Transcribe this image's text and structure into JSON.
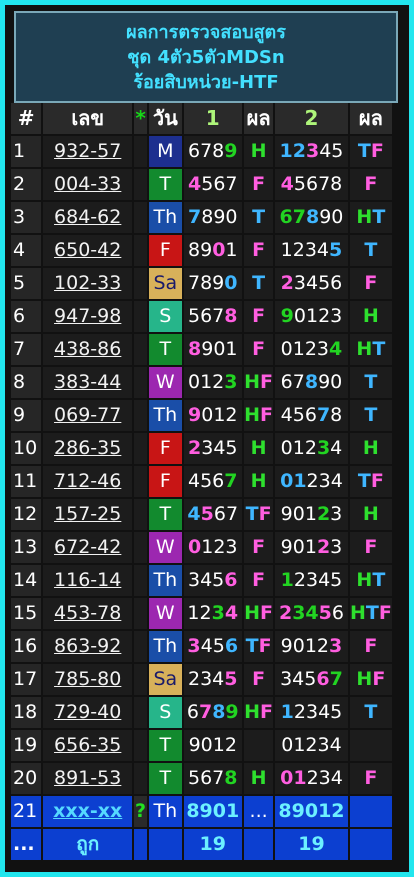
{
  "header": {
    "line1": "ผลการตรวจสอบสูตร",
    "line2": "ชุด 4ตัว5ตัวMDSn",
    "line3": "ร้อยสิบหน่วย-HTF"
  },
  "columns": {
    "idx": "#",
    "lek": "เลข",
    "star": "*",
    "day": "วัน",
    "set1": "1",
    "res1": "ผล",
    "set2": "2",
    "res2": "ผล"
  },
  "rows": [
    {
      "idx": "1",
      "lek": "932-57",
      "day": "M",
      "n1": [
        [
          "678",
          ""
        ],
        [
          "9",
          "h-green"
        ]
      ],
      "r1": "H",
      "n2": [
        [
          "12",
          "h-blue"
        ],
        [
          "3",
          "h-pink"
        ],
        [
          "45",
          ""
        ]
      ],
      "r2": "TF"
    },
    {
      "idx": "2",
      "lek": "004-33",
      "day": "T",
      "n1": [
        [
          "4",
          "h-pink"
        ],
        [
          "567",
          ""
        ]
      ],
      "r1": "F",
      "n2": [
        [
          "4",
          "h-pink"
        ],
        [
          "5678",
          ""
        ]
      ],
      "r2": "F"
    },
    {
      "idx": "3",
      "lek": "684-62",
      "day": "Th",
      "n1": [
        [
          "7",
          "h-blue"
        ],
        [
          "890",
          ""
        ]
      ],
      "r1": "T",
      "n2": [
        [
          "67",
          "h-green"
        ],
        [
          "8",
          "h-blue"
        ],
        [
          "90",
          ""
        ]
      ],
      "r2": "HT"
    },
    {
      "idx": "4",
      "lek": "650-42",
      "day": "F",
      "n1": [
        [
          "89",
          ""
        ],
        [
          "0",
          "h-pink"
        ],
        [
          "1",
          ""
        ]
      ],
      "r1": "F",
      "n2": [
        [
          "1234",
          ""
        ],
        [
          "5",
          "h-blue"
        ]
      ],
      "r2": "T"
    },
    {
      "idx": "5",
      "lek": "102-33",
      "day": "Sa",
      "n1": [
        [
          "789",
          ""
        ],
        [
          "0",
          "h-blue"
        ]
      ],
      "r1": "T",
      "n2": [
        [
          "2",
          "h-pink"
        ],
        [
          "3456",
          ""
        ]
      ],
      "r2": "F"
    },
    {
      "idx": "6",
      "lek": "947-98",
      "day": "S",
      "n1": [
        [
          "567",
          ""
        ],
        [
          "8",
          "h-pink"
        ]
      ],
      "r1": "F",
      "n2": [
        [
          "9",
          "h-green"
        ],
        [
          "0123",
          ""
        ]
      ],
      "r2": "H"
    },
    {
      "idx": "7",
      "lek": "438-86",
      "day": "T",
      "n1": [
        [
          "8",
          "h-pink"
        ],
        [
          "901",
          ""
        ]
      ],
      "r1": "F",
      "n2": [
        [
          "0123",
          ""
        ],
        [
          "4",
          "h-green"
        ]
      ],
      "r2": "HT"
    },
    {
      "idx": "8",
      "lek": "383-44",
      "day": "W",
      "n1": [
        [
          "012",
          ""
        ],
        [
          "3",
          "h-green"
        ]
      ],
      "r1": "HF",
      "n2": [
        [
          "67",
          ""
        ],
        [
          "8",
          "h-blue"
        ],
        [
          "90",
          ""
        ]
      ],
      "r2": "T"
    },
    {
      "idx": "9",
      "lek": "069-77",
      "day": "Th",
      "n1": [
        [
          "9",
          "h-pink"
        ],
        [
          "012",
          ""
        ]
      ],
      "r1": "HF",
      "n2": [
        [
          "456",
          ""
        ],
        [
          "7",
          "h-blue"
        ],
        [
          "8",
          ""
        ]
      ],
      "r2": "T"
    },
    {
      "idx": "10",
      "lek": "286-35",
      "day": "F",
      "n1": [
        [
          "2",
          "h-pink"
        ],
        [
          "345",
          ""
        ]
      ],
      "r1": "H",
      "n2": [
        [
          "012",
          ""
        ],
        [
          "3",
          "h-green"
        ],
        [
          "4",
          ""
        ]
      ],
      "r2": "H"
    },
    {
      "idx": "11",
      "lek": "712-46",
      "day": "F",
      "n1": [
        [
          "456",
          ""
        ],
        [
          "7",
          "h-green"
        ]
      ],
      "r1": "H",
      "n2": [
        [
          "01",
          "h-blue"
        ],
        [
          "2",
          ""
        ],
        [
          "34",
          ""
        ]
      ],
      "r2": "TF"
    },
    {
      "idx": "12",
      "lek": "157-25",
      "day": "T",
      "n1": [
        [
          "4",
          "h-blue"
        ],
        [
          "5",
          "h-pink"
        ],
        [
          "67",
          ""
        ]
      ],
      "r1": "TF",
      "n2": [
        [
          "901",
          ""
        ],
        [
          "2",
          "h-green"
        ],
        [
          "3",
          ""
        ]
      ],
      "r2": "H"
    },
    {
      "idx": "13",
      "lek": "672-42",
      "day": "W",
      "n1": [
        [
          "0",
          "h-pink"
        ],
        [
          "123",
          ""
        ]
      ],
      "r1": "F",
      "n2": [
        [
          "901",
          ""
        ],
        [
          "2",
          "h-pink"
        ],
        [
          "3",
          ""
        ]
      ],
      "r2": "F"
    },
    {
      "idx": "14",
      "lek": "116-14",
      "day": "Th",
      "n1": [
        [
          "345",
          ""
        ],
        [
          "6",
          "h-pink"
        ]
      ],
      "r1": "F",
      "n2": [
        [
          "1",
          "h-green"
        ],
        [
          "2345",
          ""
        ]
      ],
      "r2": "HT"
    },
    {
      "idx": "15",
      "lek": "453-78",
      "day": "W",
      "n1": [
        [
          "12",
          ""
        ],
        [
          "3",
          "h-green"
        ],
        [
          "4",
          "h-pink"
        ]
      ],
      "r1": "HF",
      "n2": [
        [
          "2",
          "h-pink"
        ],
        [
          "34",
          "h-green"
        ],
        [
          "5",
          "h-pink"
        ],
        [
          "6",
          ""
        ]
      ],
      "r2": "HTF"
    },
    {
      "idx": "16",
      "lek": "863-92",
      "day": "Th",
      "n1": [
        [
          "3",
          "h-pink"
        ],
        [
          "45",
          ""
        ],
        [
          "6",
          "h-blue"
        ]
      ],
      "r1": "TF",
      "n2": [
        [
          "9012",
          ""
        ],
        [
          "3",
          "h-pink"
        ]
      ],
      "r2": "F"
    },
    {
      "idx": "17",
      "lek": "785-80",
      "day": "Sa",
      "n1": [
        [
          "234",
          ""
        ],
        [
          "5",
          "h-pink"
        ]
      ],
      "r1": "F",
      "n2": [
        [
          "345",
          ""
        ],
        [
          "6",
          "h-pink"
        ],
        [
          "7",
          "h-green"
        ]
      ],
      "r2": "HF"
    },
    {
      "idx": "18",
      "lek": "729-40",
      "day": "S",
      "n1": [
        [
          "6",
          ""
        ],
        [
          "7",
          "h-pink"
        ],
        [
          "8",
          "h-blue"
        ],
        [
          "9",
          "h-green"
        ]
      ],
      "r1": "HF",
      "n2": [
        [
          "1",
          "h-blue"
        ],
        [
          "2345",
          ""
        ]
      ],
      "r2": "T"
    },
    {
      "idx": "19",
      "lek": "656-35",
      "day": "T",
      "n1": [
        [
          "9012",
          ""
        ]
      ],
      "r1": "",
      "n2": [
        [
          "01234",
          ""
        ]
      ],
      "r2": ""
    },
    {
      "idx": "20",
      "lek": "891-53",
      "day": "T",
      "n1": [
        [
          "567",
          ""
        ],
        [
          "8",
          "h-green"
        ]
      ],
      "r1": "H",
      "n2": [
        [
          "01",
          "h-pink"
        ],
        [
          "234",
          ""
        ]
      ],
      "r2": "F"
    }
  ],
  "current": {
    "idx": "21",
    "lek": "xxx-xx",
    "star": "?",
    "day": "Th",
    "n1": "8901",
    "r1": "...",
    "n2": "89012",
    "r2": ""
  },
  "summary": {
    "idx": "...",
    "label": "ถูก",
    "count1": "19",
    "count2": "19"
  }
}
